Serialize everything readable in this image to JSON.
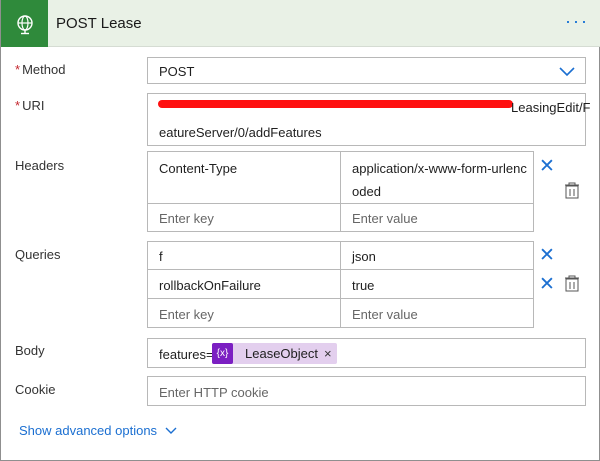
{
  "header": {
    "title": "POST Lease",
    "more_glyph": "···"
  },
  "method": {
    "label": "Method",
    "required": "*",
    "value": "POST"
  },
  "uri": {
    "label": "URI",
    "required": "*",
    "line1_visible": "LeasingEdit/F",
    "line2": "eatureServer/0/addFeatures"
  },
  "headers": {
    "label": "Headers",
    "rows": [
      {
        "key": "Content-Type",
        "value_line1": "application/x-www-form-urlenc",
        "value_line2": "oded"
      }
    ],
    "key_placeholder": "Enter key",
    "value_placeholder": "Enter value"
  },
  "queries": {
    "label": "Queries",
    "rows": [
      {
        "key": "f",
        "value": "json"
      },
      {
        "key": "rollbackOnFailure",
        "value": "true"
      }
    ],
    "key_placeholder": "Enter key",
    "value_placeholder": "Enter value"
  },
  "body": {
    "label": "Body",
    "prefix": "features=",
    "token_icon": "{x}",
    "token_label": "LeaseObject",
    "token_remove": "×"
  },
  "cookie": {
    "label": "Cookie",
    "placeholder": "Enter HTTP cookie"
  },
  "advanced": {
    "label": "Show advanced options"
  },
  "colors": {
    "accent": "#1b6fd1",
    "header_bg": "#e9f1e6",
    "app_icon_bg": "#2f8a3b",
    "token_bg": "#e3cfee",
    "token_icon_bg": "#7b1fc2",
    "required": "#c4262e"
  }
}
